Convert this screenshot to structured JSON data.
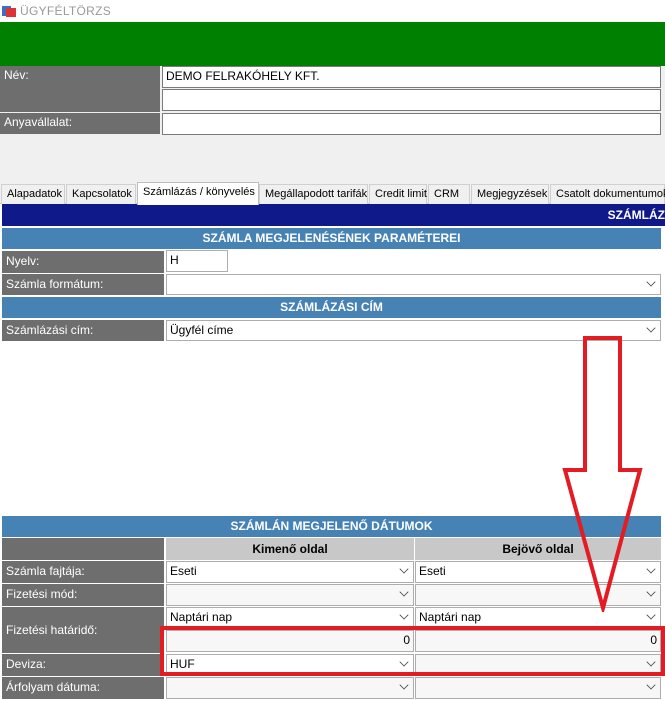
{
  "window": {
    "title": "ÜGYFÉLTÖRZS"
  },
  "header": {
    "name_label": "Név:",
    "name_value": "DEMO FELRAKÓHELY KFT.",
    "name_value2": "",
    "parent_label": "Anyavállalat:",
    "parent_value": ""
  },
  "tabs": [
    {
      "label": "Alapadatok"
    },
    {
      "label": "Kapcsolatok"
    },
    {
      "label": "Számlázás / könyvelés"
    },
    {
      "label": "Megállapodott tarifák"
    },
    {
      "label": "Credit limit"
    },
    {
      "label": "CRM"
    },
    {
      "label": "Megjegyzések"
    },
    {
      "label": "Csatolt dokumentumok"
    }
  ],
  "panel": {
    "top_bar_title": "SZÁMLÁZ",
    "invoice_params": {
      "title": "SZÁMLA MEGJELENÉSÉNEK PARAMÉTEREI",
      "language_label": "Nyelv:",
      "language_value": "H",
      "format_label": "Számla formátum:",
      "format_value": ""
    },
    "billing_address": {
      "title": "SZÁMLÁZÁSI CÍM",
      "label": "Számlázási cím:",
      "value": "Ügyfél címe"
    },
    "dates": {
      "title": "SZÁMLÁN MEGJELENŐ DÁTUMOK",
      "col_out": "Kimenő oldal",
      "col_in": "Bejövő oldal",
      "invoice_type_label": "Számla fajtája:",
      "invoice_type_out": "Eseti",
      "invoice_type_in": "Eseti",
      "payment_method_label": "Fizetési mód:",
      "payment_method_out": "",
      "payment_method_in": "",
      "deadline_label": "Fizetési határidő:",
      "deadline_type_out": "Naptári nap",
      "deadline_type_in": "Naptári nap",
      "deadline_days_out": "0",
      "deadline_days_in": "0",
      "currency_label": "Deviza:",
      "currency_out": "HUF",
      "currency_in": "",
      "rate_date_label": "Árfolyam dátuma:",
      "rate_date_out": "",
      "rate_date_in": ""
    }
  },
  "annotation_color": "#e31b23",
  "colors": {
    "green_bar": "#008000",
    "section_header": "#4682b4",
    "top_bar": "#10198a",
    "label_bg": "#6e6e6e"
  }
}
